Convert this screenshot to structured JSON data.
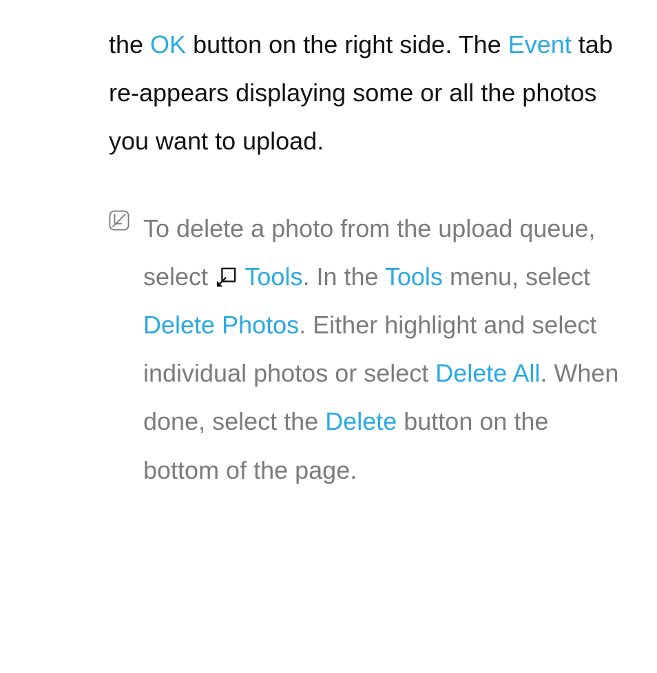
{
  "para1": {
    "s0": "the ",
    "link_ok": "OK",
    "s1": " button on the right side. The ",
    "link_event": "Event",
    "s2": " tab re-appears displaying some or all the photos you want to upload."
  },
  "note": {
    "s0": "To delete a photo from the upload queue, select ",
    "link_tools1": "Tools",
    "s1": ". In the ",
    "link_tools2": "Tools",
    "s2": " menu, select ",
    "link_delete_photos": "Delete Photos",
    "s3": ". Either highlight and select individual photos or select ",
    "link_delete_all": "Delete All",
    "s4": ". When done, select the ",
    "link_delete": "Delete",
    "s5": " button on the bottom of the page."
  }
}
